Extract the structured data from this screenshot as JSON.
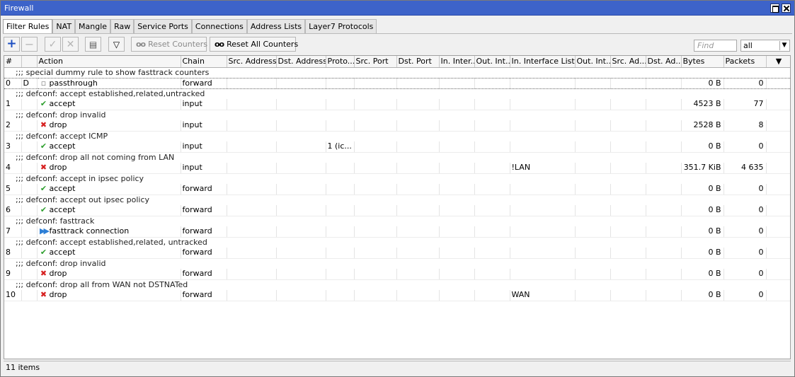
{
  "window": {
    "title": "Firewall"
  },
  "tabs": [
    {
      "label": "Filter Rules",
      "active": true
    },
    {
      "label": "NAT"
    },
    {
      "label": "Mangle"
    },
    {
      "label": "Raw"
    },
    {
      "label": "Service Ports"
    },
    {
      "label": "Connections"
    },
    {
      "label": "Address Lists"
    },
    {
      "label": "Layer7 Protocols"
    }
  ],
  "toolbar": {
    "add_icon": "plus-icon",
    "remove_icon": "minus-icon",
    "enable_icon": "check-icon",
    "disable_icon": "x-icon",
    "comment_icon": "comment-icon",
    "filter_icon": "funnel-icon",
    "reset_counters_label": "Reset Counters",
    "reset_all_counters_label": "Reset All Counters",
    "find_placeholder": "Find",
    "filter_value": "all"
  },
  "columns": [
    "#",
    "",
    "Action",
    "Chain",
    "Src. Address",
    "Dst. Address",
    "Proto...",
    "Src. Port",
    "Dst. Port",
    "In. Inter...",
    "Out. Int...",
    "In. Interface List",
    "Out. Int...",
    "Src. Ad...",
    "Dst. Ad...",
    "Bytes",
    "Packets"
  ],
  "rows": [
    {
      "comment": ";;; special dummy rule to show fasttrack counters"
    },
    {
      "num": "0",
      "flag": "D",
      "action": "passthrough",
      "icon": "passthrough",
      "chain": "forward",
      "proto": "",
      "in_list": "",
      "bytes": "0 B",
      "packets": "0",
      "selected": true
    },
    {
      "comment": ";;; defconf: accept established,related,untracked"
    },
    {
      "num": "1",
      "flag": "",
      "action": "accept",
      "icon": "accept",
      "chain": "input",
      "proto": "",
      "in_list": "",
      "bytes": "4523 B",
      "packets": "77"
    },
    {
      "comment": ";;; defconf: drop invalid"
    },
    {
      "num": "2",
      "flag": "",
      "action": "drop",
      "icon": "drop",
      "chain": "input",
      "proto": "",
      "in_list": "",
      "bytes": "2528 B",
      "packets": "8"
    },
    {
      "comment": ";;; defconf: accept ICMP"
    },
    {
      "num": "3",
      "flag": "",
      "action": "accept",
      "icon": "accept",
      "chain": "input",
      "proto": "1 (ic...",
      "in_list": "",
      "bytes": "0 B",
      "packets": "0"
    },
    {
      "comment": ";;; defconf: drop all not coming from LAN"
    },
    {
      "num": "4",
      "flag": "",
      "action": "drop",
      "icon": "drop",
      "chain": "input",
      "proto": "",
      "in_list": "!LAN",
      "bytes": "351.7 KiB",
      "packets": "4 635"
    },
    {
      "comment": ";;; defconf: accept in ipsec policy"
    },
    {
      "num": "5",
      "flag": "",
      "action": "accept",
      "icon": "accept",
      "chain": "forward",
      "proto": "",
      "in_list": "",
      "bytes": "0 B",
      "packets": "0"
    },
    {
      "comment": ";;; defconf: accept out ipsec policy"
    },
    {
      "num": "6",
      "flag": "",
      "action": "accept",
      "icon": "accept",
      "chain": "forward",
      "proto": "",
      "in_list": "",
      "bytes": "0 B",
      "packets": "0"
    },
    {
      "comment": ";;; defconf: fasttrack"
    },
    {
      "num": "7",
      "flag": "",
      "action": "fasttrack connection",
      "icon": "fasttrack",
      "chain": "forward",
      "proto": "",
      "in_list": "",
      "bytes": "0 B",
      "packets": "0"
    },
    {
      "comment": ";;; defconf: accept established,related, untracked"
    },
    {
      "num": "8",
      "flag": "",
      "action": "accept",
      "icon": "accept",
      "chain": "forward",
      "proto": "",
      "in_list": "",
      "bytes": "0 B",
      "packets": "0"
    },
    {
      "comment": ";;; defconf: drop invalid"
    },
    {
      "num": "9",
      "flag": "",
      "action": "drop",
      "icon": "drop",
      "chain": "forward",
      "proto": "",
      "in_list": "",
      "bytes": "0 B",
      "packets": "0"
    },
    {
      "comment": ";;; defconf: drop all from WAN not DSTNATed"
    },
    {
      "num": "10",
      "flag": "",
      "action": "drop",
      "icon": "drop",
      "chain": "forward",
      "proto": "",
      "in_list": "WAN",
      "bytes": "0 B",
      "packets": "0"
    }
  ],
  "status": {
    "items_text": "11 items"
  },
  "icons": {
    "accept": "✔",
    "drop": "✖",
    "fasttrack": "▶▶",
    "passthrough": "▫"
  }
}
